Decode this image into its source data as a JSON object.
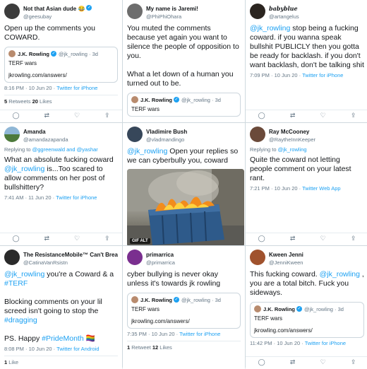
{
  "tweets": [
    {
      "name": "Not that Asian dude 😂",
      "handle": "@geesubay",
      "text": "Open up the comments you COWARD.",
      "quote": {
        "name": "J.K. Rowling",
        "handle": "@jk_rowling · 3d",
        "lines": [
          "TERF wars",
          "jkrowling.com/answers/"
        ]
      },
      "time": "8:16 PM · 10 Jun 20 · ",
      "app": "Twitter for iPhone",
      "retweets": "5",
      "retweets_label": " Retweets ",
      "likes": "20",
      "likes_label": " Likes"
    },
    {
      "name": "My name is Jaremi!",
      "handle": "@PhiPhiOhara",
      "text": "You muted the comments because yet again you want to silence the people of opposition to you.\n\nWhat a let down of a human you turned out to be.",
      "quote": {
        "name": "J.K. Rowling",
        "handle": "@jk_rowling · 3d",
        "lines": [
          "TERF wars"
        ]
      }
    },
    {
      "name": "babyblue",
      "handle": "@artangelus",
      "text_mention": "@jk_rowling",
      "text": " stop being a fucking coward. if you wanna speak bullshit PUBLICLY then you gotta be ready for backlash. if you don't want backlash, don't be talking shit",
      "time": "7:09 PM · 10 Jun 20 · ",
      "app": "Twitter for iPhone"
    },
    {
      "name": "Amanda",
      "handle": "@amandazapanda",
      "replying": "Replying to ",
      "replying_to": "@ggreenwald and @yashar",
      "text_a": "What an absolute fucking coward ",
      "text_mention": "@jk_rowling",
      "text_b": " is...Too scared to allow comments on her post of bullshittery?",
      "time": "7:41 AM · 11 Jun 20 · ",
      "app": "Twitter for iPhone"
    },
    {
      "name": "Vladimire Bush",
      "handle": "@vladmandingo",
      "text_mention": "@jk_rowling",
      "text": " Open your replies so we can cyberbully you, coward",
      "gif_badge": "GIF  ALT"
    },
    {
      "name": "Ray McCooney",
      "handle": "@RaytheInnKeeper",
      "replying": "Replying to ",
      "replying_to": "@jk_rowling",
      "text": "Quite the coward not letting people comment on your latest rant.",
      "time": "7:21 PM · 10 Jun 20 · ",
      "app": "Twitter Web App"
    },
    {
      "name": "The ResistanceMobile™ Can't Breathe",
      "handle": "@CatinaVanRsistn",
      "text_mention": "@jk_rowling",
      "text_a": " you're a Coward & a ",
      "hashtag1": "#TERF",
      "text_b": "\n\nBlocking comments on your lil screed isn't going to stop the ",
      "hashtag2": "#dragging",
      "text_c": "\n\nPS. Happy ",
      "hashtag3": "#PrideMonth",
      "emoji": " 🏳️‍🌈",
      "time": "8:08 PM · 10 Jun 20 · ",
      "app": "Twitter for Android",
      "likes": "1",
      "likes_label": " Like"
    },
    {
      "name": "primarrica",
      "handle": "@primarrica",
      "text": "cyber bullying is never okay unless it's towards jk rowling",
      "quote": {
        "name": "J.K. Rowling",
        "handle": "@jk_rowling · 3d",
        "lines": [
          "TERF wars",
          "jkrowling.com/answers/"
        ]
      },
      "time": "7:35 PM · 10 Jun 20 · ",
      "app": "Twitter for iPhone",
      "retweets": "1",
      "retweets_label": " Retweet ",
      "likes": "12",
      "likes_label": " Likes"
    },
    {
      "name": "Kween Jenni",
      "handle": "@JenniKween",
      "text_a": "This fucking coward. ",
      "text_mention": "@jk_rowling",
      "text_b": " , you are a total bitch. Fuck you sideways.",
      "quote": {
        "name": "J.K. Rowling",
        "handle": "@jk_rowling · 3d",
        "lines": [
          "TERF wars",
          "jkrowling.com/answers/"
        ]
      },
      "time": "11:42 PM · 10 Jun 20 · ",
      "app": "Twitter for iPhone"
    }
  ],
  "actions": [
    "◯",
    "⇄",
    "♡",
    "⇪"
  ],
  "verified_mark": "✓",
  "colors": {
    "link": "#1da1f2",
    "muted": "#657786",
    "text": "#14171a"
  }
}
